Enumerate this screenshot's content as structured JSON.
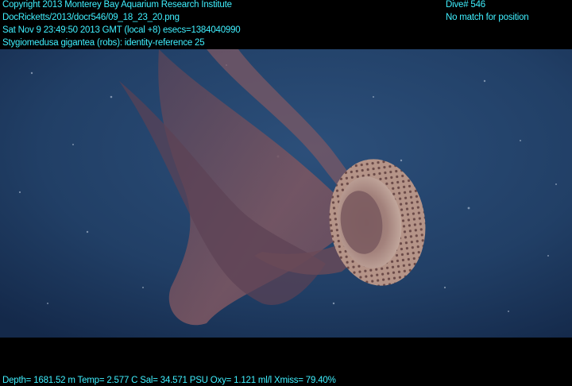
{
  "header": {
    "line1": "Copyright 2013 Monterey Bay Aquarium Research Institute",
    "line2": "DocRicketts/2013/docr546/09_18_23_20.png",
    "line3": "Sat Nov  9 23:49:50 2013 GMT (local +8)  esecs=1384040990",
    "line4": "Stygiomedusa gigantea (robs): identity-reference 25",
    "dive": "Dive# 546",
    "position": "No match for position"
  },
  "footer": {
    "telemetry": "Depth= 1681.52 m  Temp= 2.577 C  Sal= 34.571 PSU  Oxy= 1.121 ml/l  Xmiss= 79.40%"
  },
  "colors": {
    "overlay_text": "#3ff0ff",
    "water": "#1f3d64",
    "jelly_arms": "#6e4f5c",
    "bell": "#b89a92"
  }
}
